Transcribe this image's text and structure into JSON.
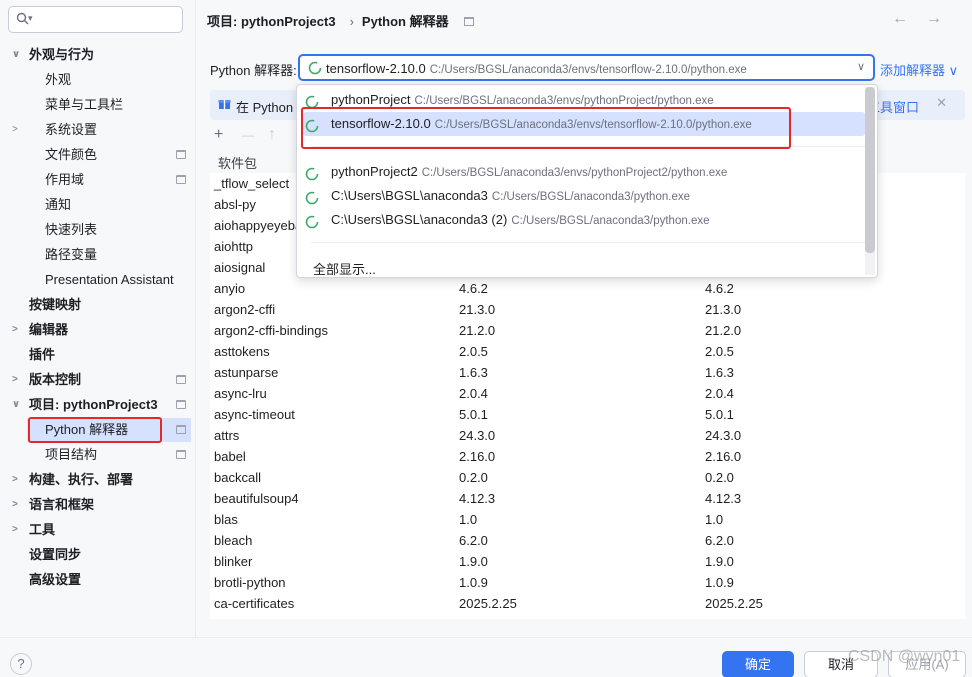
{
  "search": {
    "icon": "search-icon",
    "dropdown": "▾"
  },
  "sidebar": {
    "items": [
      {
        "label": "外观与行为",
        "level": 0,
        "chev": "∨",
        "bold": true
      },
      {
        "label": "外观",
        "level": 1
      },
      {
        "label": "菜单与工具栏",
        "level": 1
      },
      {
        "label": "系统设置",
        "level": 1,
        "chev": ">"
      },
      {
        "label": "文件颜色",
        "level": 1,
        "page": true
      },
      {
        "label": "作用域",
        "level": 1,
        "page": true
      },
      {
        "label": "通知",
        "level": 1
      },
      {
        "label": "快速列表",
        "level": 1
      },
      {
        "label": "路径变量",
        "level": 1
      },
      {
        "label": "Presentation Assistant",
        "level": 1
      },
      {
        "label": "按键映射",
        "level": 0,
        "bold": true
      },
      {
        "label": "编辑器",
        "level": 0,
        "chev": ">",
        "bold": true
      },
      {
        "label": "插件",
        "level": 0,
        "bold": true
      },
      {
        "label": "版本控制",
        "level": 0,
        "chev": ">",
        "bold": true,
        "page": true
      },
      {
        "label": "项目: pythonProject3",
        "level": 0,
        "chev": "∨",
        "bold": true,
        "page": true
      },
      {
        "label": "Python 解释器",
        "level": 1,
        "page": true,
        "selected": true
      },
      {
        "label": "项目结构",
        "level": 1,
        "page": true
      },
      {
        "label": "构建、执行、部署",
        "level": 0,
        "chev": ">",
        "bold": true
      },
      {
        "label": "语言和框架",
        "level": 0,
        "chev": ">",
        "bold": true
      },
      {
        "label": "工具",
        "level": 0,
        "chev": ">",
        "bold": true
      },
      {
        "label": "设置同步",
        "level": 0,
        "bold": true
      },
      {
        "label": "高级设置",
        "level": 0,
        "bold": true
      }
    ]
  },
  "breadcrumb": {
    "project": "项目: pythonProject3",
    "sep": "›",
    "page": "Python 解释器",
    "back": "←",
    "forward": "→"
  },
  "interpreter": {
    "label": "Python 解释器:",
    "name": "tensorflow-2.10.0",
    "path": "C:/Users/BGSL/anaconda3/envs/tensorflow-2.10.0/python.exe",
    "dropdown": "∨",
    "add_label": "添加解释器 ∨"
  },
  "info_bar": {
    "text": "在 Python",
    "link": "工具窗口",
    "close": "✕"
  },
  "toolbar": {
    "add": "+",
    "remove": "—",
    "up": "↑"
  },
  "table": {
    "headers": [
      "软件包",
      "",
      ""
    ],
    "rows": [
      {
        "name": "_tflow_select",
        "ver": "",
        "latest": ""
      },
      {
        "name": "absl-py",
        "ver": "",
        "latest": ""
      },
      {
        "name": "aiohappyeyeballs",
        "ver": "",
        "latest": ""
      },
      {
        "name": "aiohttp",
        "ver": "",
        "latest": ""
      },
      {
        "name": "aiosignal",
        "ver": "",
        "latest": ""
      },
      {
        "name": "anyio",
        "ver": "4.6.2",
        "latest": "4.6.2"
      },
      {
        "name": "argon2-cffi",
        "ver": "21.3.0",
        "latest": "21.3.0"
      },
      {
        "name": "argon2-cffi-bindings",
        "ver": "21.2.0",
        "latest": "21.2.0"
      },
      {
        "name": "asttokens",
        "ver": "2.0.5",
        "latest": "2.0.5"
      },
      {
        "name": "astunparse",
        "ver": "1.6.3",
        "latest": "1.6.3"
      },
      {
        "name": "async-lru",
        "ver": "2.0.4",
        "latest": "2.0.4"
      },
      {
        "name": "async-timeout",
        "ver": "5.0.1",
        "latest": "5.0.1"
      },
      {
        "name": "attrs",
        "ver": "24.3.0",
        "latest": "24.3.0"
      },
      {
        "name": "babel",
        "ver": "2.16.0",
        "latest": "2.16.0"
      },
      {
        "name": "backcall",
        "ver": "0.2.0",
        "latest": "0.2.0"
      },
      {
        "name": "beautifulsoup4",
        "ver": "4.12.3",
        "latest": "4.12.3"
      },
      {
        "name": "blas",
        "ver": "1.0",
        "latest": "1.0"
      },
      {
        "name": "bleach",
        "ver": "6.2.0",
        "latest": "6.2.0"
      },
      {
        "name": "blinker",
        "ver": "1.9.0",
        "latest": "1.9.0"
      },
      {
        "name": "brotli-python",
        "ver": "1.0.9",
        "latest": "1.0.9"
      },
      {
        "name": "ca-certificates",
        "ver": "2025.2.25",
        "latest": "2025.2.25"
      }
    ]
  },
  "popup": {
    "items": [
      {
        "name": "pythonProject",
        "path": "C:/Users/BGSL/anaconda3/envs/pythonProject/python.exe"
      },
      {
        "name": "tensorflow-2.10.0",
        "path": "C:/Users/BGSL/anaconda3/envs/tensorflow-2.10.0/python.exe",
        "selected": true
      },
      {
        "name": "pythonProject2",
        "path": "C:/Users/BGSL/anaconda3/envs/pythonProject2/python.exe"
      },
      {
        "name": "C:\\Users\\BGSL\\anaconda3",
        "path": "C:/Users/BGSL/anaconda3/python.exe"
      },
      {
        "name": "C:\\Users\\BGSL\\anaconda3 (2)",
        "path": "C:/Users/BGSL/anaconda3/python.exe"
      }
    ],
    "show_all": "全部显示..."
  },
  "footer": {
    "help": "?",
    "ok": "确定",
    "cancel": "取消",
    "apply": "应用(A)"
  },
  "watermark": "CSDN @wyn01",
  "colors": {
    "accent": "#3574f0",
    "selection": "#d5e1ff",
    "highlight_box": "#e22a2a",
    "spinner": "#3daa6a"
  }
}
